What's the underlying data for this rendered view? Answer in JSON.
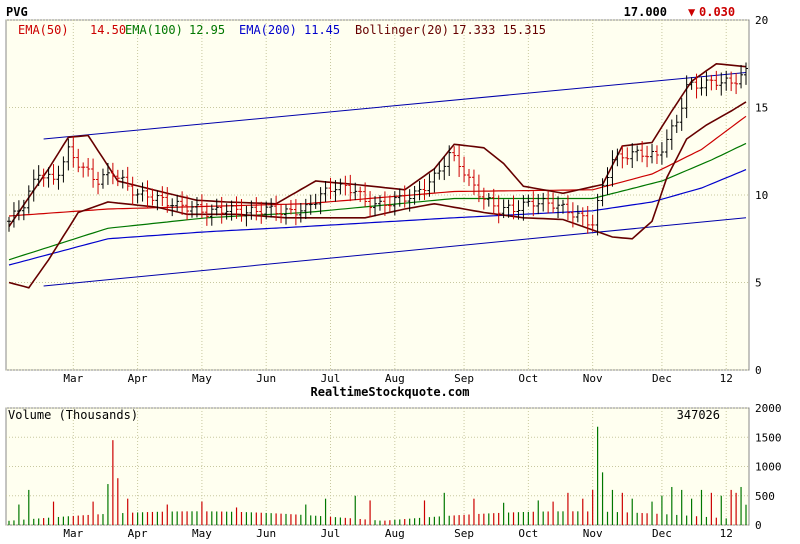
{
  "header": {
    "symbol": "PVG",
    "last_price": "17.000",
    "change_arrow": "▼",
    "change": "0.030"
  },
  "legend": [
    {
      "label": "EMA(50)",
      "value": "14.50",
      "color": "#cc0000"
    },
    {
      "label": "EMA(100)",
      "value": "12.95",
      "color": "#007700"
    },
    {
      "label": "EMA(200)",
      "value": "11.45",
      "color": "#0000cc"
    },
    {
      "label": "Bollinger(20)",
      "value": "17.333 15.315",
      "color": "#660000"
    }
  ],
  "watermark": "RealtimeStockquote.com",
  "colors": {
    "background": "#fffff0",
    "grid": "#c8c8a0",
    "up_bar": "#000000",
    "down_bar": "#cc0000",
    "channel": "#0000aa",
    "volume_up": "#007700",
    "volume_down": "#cc0000"
  },
  "chart_data": [
    {
      "type": "candlestick-line",
      "title": "PVG",
      "x_labels": [
        "Mar",
        "Apr",
        "May",
        "Jun",
        "Jul",
        "Aug",
        "Sep",
        "Oct",
        "Nov",
        "Dec",
        "12"
      ],
      "ylim": [
        0,
        20
      ],
      "y_ticks": [
        0,
        5,
        10,
        15,
        20
      ],
      "grid": true,
      "price_anchors": [
        [
          0,
          8.5
        ],
        [
          3,
          9.5
        ],
        [
          6,
          11.3
        ],
        [
          9,
          10.8
        ],
        [
          12,
          12.5
        ],
        [
          15,
          11.5
        ],
        [
          18,
          10.8
        ],
        [
          21,
          11.3
        ],
        [
          24,
          10.5
        ],
        [
          26,
          10.0
        ],
        [
          28,
          10.0
        ],
        [
          30,
          9.8
        ],
        [
          34,
          9.4
        ],
        [
          37,
          9.3
        ],
        [
          40,
          9.0
        ],
        [
          44,
          9.2
        ],
        [
          48,
          9.0
        ],
        [
          52,
          9.2
        ],
        [
          56,
          9.0
        ],
        [
          60,
          9.2
        ],
        [
          63,
          10.0
        ],
        [
          66,
          10.5
        ],
        [
          70,
          10.3
        ],
        [
          72,
          9.6
        ],
        [
          75,
          9.4
        ],
        [
          78,
          9.7
        ],
        [
          82,
          10.0
        ],
        [
          86,
          11.0
        ],
        [
          89,
          12.3
        ],
        [
          91,
          11.8
        ],
        [
          93,
          10.8
        ],
        [
          96,
          9.8
        ],
        [
          99,
          9.2
        ],
        [
          102,
          9.2
        ],
        [
          106,
          9.6
        ],
        [
          110,
          9.5
        ],
        [
          113,
          9.1
        ],
        [
          115,
          8.8
        ],
        [
          117,
          8.5
        ],
        [
          118,
          8.4
        ],
        [
          120,
          10.5
        ],
        [
          122,
          12.0
        ],
        [
          125,
          12.3
        ],
        [
          128,
          12.4
        ],
        [
          131,
          12.2
        ],
        [
          133,
          13.2
        ],
        [
          135,
          14.2
        ],
        [
          137,
          16.2
        ],
        [
          140,
          16.3
        ],
        [
          143,
          16.5
        ],
        [
          146,
          16.4
        ],
        [
          149,
          17.0
        ]
      ],
      "ema50": [
        [
          0,
          8.8
        ],
        [
          20,
          9.2
        ],
        [
          60,
          9.5
        ],
        [
          90,
          10.2
        ],
        [
          118,
          10.3
        ],
        [
          130,
          11.2
        ],
        [
          140,
          12.6
        ],
        [
          149,
          14.5
        ]
      ],
      "ema100": [
        [
          0,
          6.3
        ],
        [
          20,
          8.1
        ],
        [
          40,
          8.7
        ],
        [
          60,
          9.0
        ],
        [
          90,
          9.8
        ],
        [
          118,
          9.8
        ],
        [
          132,
          10.8
        ],
        [
          142,
          12.0
        ],
        [
          149,
          12.95
        ]
      ],
      "ema200": [
        [
          0,
          6.0
        ],
        [
          20,
          7.5
        ],
        [
          40,
          7.9
        ],
        [
          60,
          8.2
        ],
        [
          90,
          8.7
        ],
        [
          118,
          9.1
        ],
        [
          130,
          9.6
        ],
        [
          140,
          10.4
        ],
        [
          149,
          11.45
        ]
      ],
      "bollinger_upper": [
        [
          0,
          8.2
        ],
        [
          8,
          11.5
        ],
        [
          12,
          13.3
        ],
        [
          16,
          13.4
        ],
        [
          22,
          10.8
        ],
        [
          32,
          10.1
        ],
        [
          38,
          9.7
        ],
        [
          44,
          9.6
        ],
        [
          54,
          9.5
        ],
        [
          62,
          10.8
        ],
        [
          70,
          10.6
        ],
        [
          80,
          10.3
        ],
        [
          86,
          11.5
        ],
        [
          90,
          12.9
        ],
        [
          96,
          12.7
        ],
        [
          100,
          11.8
        ],
        [
          104,
          10.5
        ],
        [
          112,
          10.1
        ],
        [
          120,
          10.6
        ],
        [
          124,
          12.8
        ],
        [
          130,
          13.0
        ],
        [
          134,
          14.8
        ],
        [
          138,
          16.5
        ],
        [
          143,
          17.5
        ],
        [
          149,
          17.33
        ]
      ],
      "bollinger_lower": [
        [
          0,
          5.0
        ],
        [
          4,
          4.7
        ],
        [
          8,
          6.3
        ],
        [
          14,
          9.0
        ],
        [
          20,
          9.6
        ],
        [
          30,
          9.3
        ],
        [
          36,
          8.9
        ],
        [
          46,
          8.9
        ],
        [
          56,
          8.7
        ],
        [
          62,
          8.7
        ],
        [
          72,
          8.7
        ],
        [
          80,
          9.2
        ],
        [
          86,
          9.5
        ],
        [
          90,
          9.3
        ],
        [
          96,
          9.0
        ],
        [
          104,
          8.7
        ],
        [
          112,
          8.6
        ],
        [
          118,
          8.0
        ],
        [
          122,
          7.6
        ],
        [
          126,
          7.5
        ],
        [
          130,
          8.5
        ],
        [
          133,
          11.0
        ],
        [
          137,
          13.2
        ],
        [
          141,
          14.0
        ],
        [
          146,
          14.8
        ],
        [
          149,
          15.32
        ]
      ],
      "trend_channel_upper": [
        [
          7,
          13.2
        ],
        [
          149,
          17.0
        ]
      ],
      "trend_channel_lower": [
        [
          7,
          4.8
        ],
        [
          149,
          8.7
        ]
      ]
    },
    {
      "type": "bar",
      "title": "Volume (Thousands)",
      "last_volume": "347026",
      "ylim": [
        0,
        2000
      ],
      "y_ticks": [
        0,
        500,
        1000,
        1500,
        2000
      ],
      "x_labels": [
        "Mar",
        "Apr",
        "May",
        "Jun",
        "Jul",
        "Aug",
        "Sep",
        "Oct",
        "Nov",
        "Dec",
        "12"
      ],
      "volume_baseline": 180,
      "volume_spikes": [
        [
          2,
          350
        ],
        [
          4,
          600
        ],
        [
          9,
          400
        ],
        [
          17,
          400
        ],
        [
          20,
          700
        ],
        [
          21,
          1450
        ],
        [
          22,
          800
        ],
        [
          24,
          450
        ],
        [
          32,
          350
        ],
        [
          39,
          400
        ],
        [
          46,
          300
        ],
        [
          60,
          350
        ],
        [
          64,
          450
        ],
        [
          70,
          500
        ],
        [
          73,
          420
        ],
        [
          84,
          420
        ],
        [
          88,
          550
        ],
        [
          94,
          450
        ],
        [
          100,
          380
        ],
        [
          107,
          420
        ],
        [
          110,
          400
        ],
        [
          113,
          550
        ],
        [
          116,
          450
        ],
        [
          118,
          600
        ],
        [
          119,
          1680
        ],
        [
          120,
          900
        ],
        [
          122,
          600
        ],
        [
          124,
          550
        ],
        [
          126,
          450
        ],
        [
          130,
          400
        ],
        [
          132,
          500
        ],
        [
          134,
          650
        ],
        [
          136,
          600
        ],
        [
          138,
          450
        ],
        [
          140,
          600
        ],
        [
          142,
          550
        ],
        [
          144,
          500
        ],
        [
          146,
          600
        ],
        [
          147,
          550
        ],
        [
          148,
          650
        ],
        [
          149,
          347
        ]
      ]
    }
  ]
}
